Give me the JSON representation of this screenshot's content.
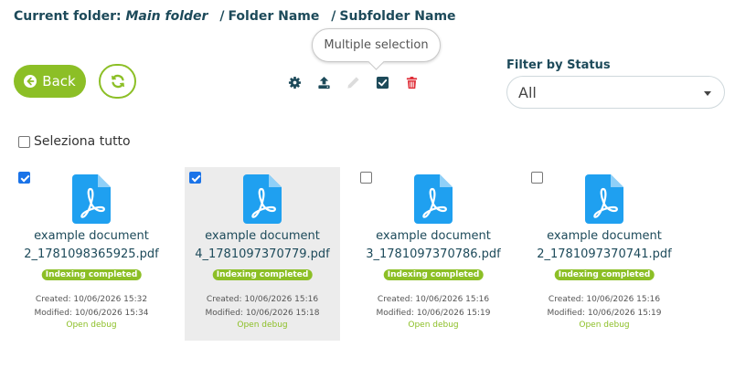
{
  "breadcrumb": {
    "label": "Current folder:",
    "main": "Main folder",
    "sep": "/",
    "folder": "Folder Name",
    "subfolder": "Subfolder Name"
  },
  "actions": {
    "back_label": "Back",
    "refresh_icon": "refresh-icon"
  },
  "toolbar": {
    "items": [
      {
        "icon": "gear-icon",
        "color": "#1d4a5a",
        "enabled": true
      },
      {
        "icon": "upload-icon",
        "color": "#1d4a5a",
        "enabled": true
      },
      {
        "icon": "pencil-icon",
        "color": "#dcdcdc",
        "enabled": false
      },
      {
        "icon": "check-square-icon",
        "color": "#1d4a5a",
        "enabled": true,
        "active": true
      },
      {
        "icon": "trash-icon",
        "color": "#e0303a",
        "enabled": true
      }
    ],
    "tooltip": "Multiple selection"
  },
  "filter": {
    "label": "Filter by Status",
    "selected": "All"
  },
  "select_all": {
    "label": "Seleziona tutto",
    "checked": false
  },
  "files": [
    {
      "name_line1": "example document",
      "name_line2": "2_1781098365925.pdf",
      "status": "Indexing completed",
      "created": "Created: 10/06/2026 15:32",
      "modified": "Modified: 10/06/2026 15:34",
      "debug": "Open debug",
      "checked": true,
      "highlighted": false
    },
    {
      "name_line1": "example document",
      "name_line2": "4_1781097370779.pdf",
      "status": "Indexing completed",
      "created": "Created: 10/06/2026 15:16",
      "modified": "Modified: 10/06/2026 15:18",
      "debug": "Open debug",
      "checked": true,
      "highlighted": true
    },
    {
      "name_line1": "example document",
      "name_line2": "3_1781097370786.pdf",
      "status": "Indexing completed",
      "created": "Created: 10/06/2026 15:16",
      "modified": "Modified: 10/06/2026 15:19",
      "debug": "Open debug",
      "checked": false,
      "highlighted": false
    },
    {
      "name_line1": "example document",
      "name_line2": "2_1781097370741.pdf",
      "status": "Indexing completed",
      "created": "Created: 10/06/2026 15:16",
      "modified": "Modified: 10/06/2026 15:19",
      "debug": "Open debug",
      "checked": false,
      "highlighted": false
    }
  ],
  "colors": {
    "accent": "#8cbf26",
    "pdf_icon": "#1fa0f0",
    "text": "#1d4a5a",
    "danger": "#e0303a"
  }
}
